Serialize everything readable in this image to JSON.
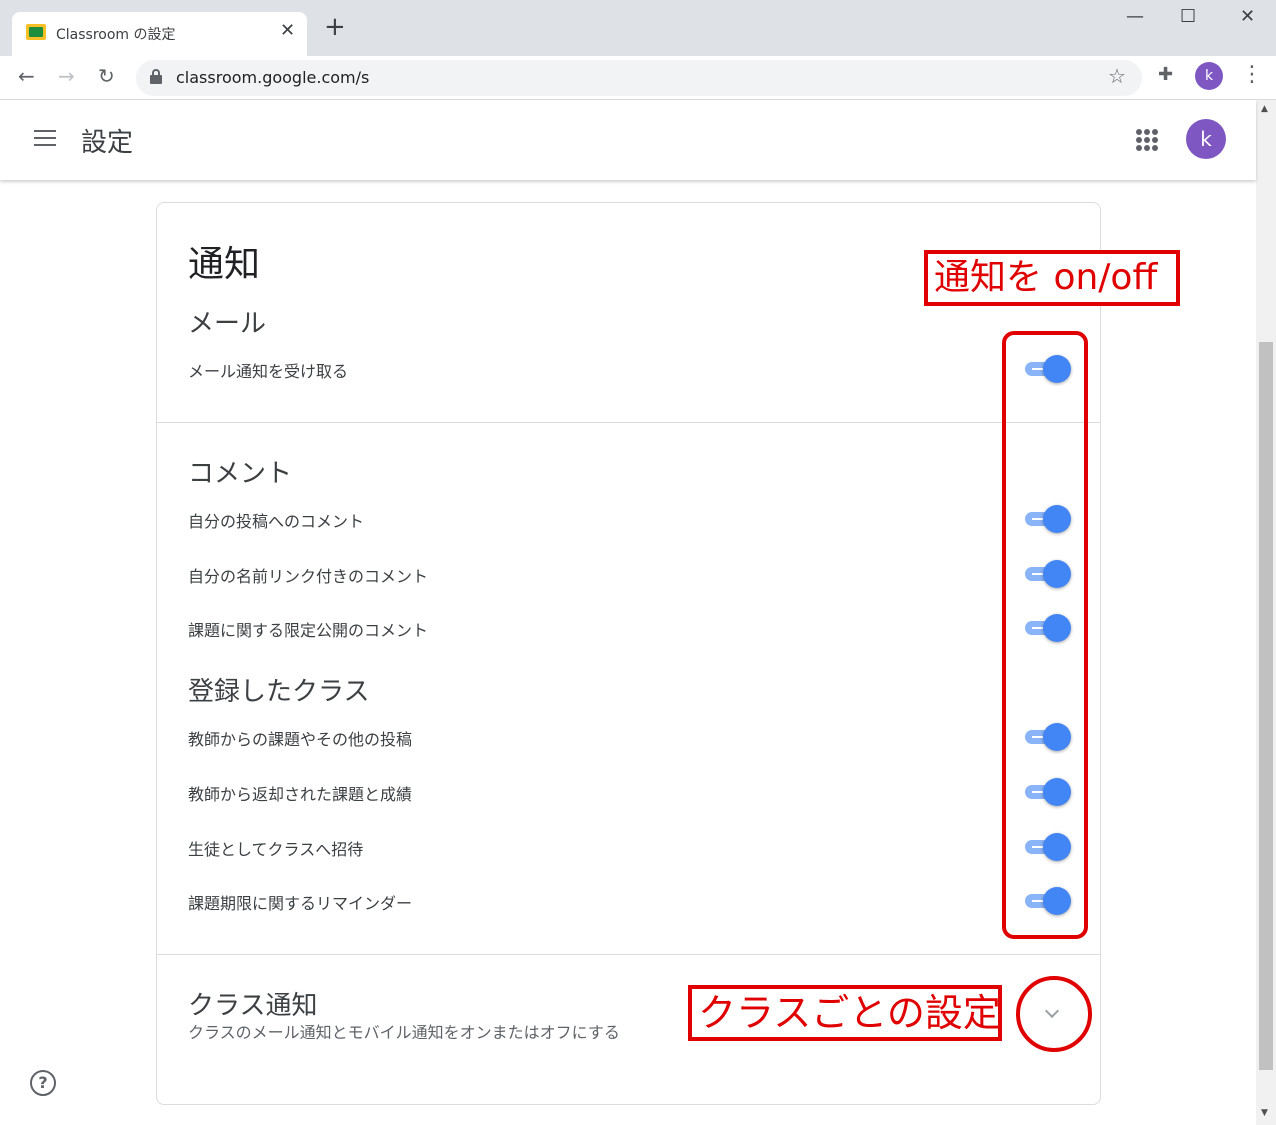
{
  "browser": {
    "tab_title": "Classroom の設定",
    "tab_close": "✕",
    "new_tab": "+",
    "url": "classroom.google.com/s",
    "profile_initial": "k",
    "win_minimize": "—",
    "win_maximize": "☐",
    "win_close": "✕"
  },
  "appbar": {
    "title": "設定",
    "profile_initial": "k"
  },
  "settings": {
    "section_title": "通知",
    "email": {
      "heading": "メール",
      "items": [
        {
          "label": "メール通知を受け取る",
          "enabled": true
        }
      ]
    },
    "comments": {
      "heading": "コメント",
      "items": [
        {
          "label": "自分の投稿へのコメント",
          "enabled": true
        },
        {
          "label": "自分の名前リンク付きのコメント",
          "enabled": true
        },
        {
          "label": "課題に関する限定公開のコメント",
          "enabled": true
        }
      ]
    },
    "classes": {
      "heading": "登録したクラス",
      "items": [
        {
          "label": "教師からの課題やその他の投稿",
          "enabled": true
        },
        {
          "label": "教師から返却された課題と成績",
          "enabled": true
        },
        {
          "label": "生徒としてクラスへ招待",
          "enabled": true
        },
        {
          "label": "課題期限に関するリマインダー",
          "enabled": true
        }
      ]
    },
    "class_notifications": {
      "heading": "クラス通知",
      "description": "クラスのメール通知とモバイル通知をオンまたはオフにする"
    }
  },
  "help_label": "?",
  "annotations": {
    "toggle_note": "通知を on/off",
    "class_note": "クラスごとの設定",
    "color": "#e00000"
  },
  "colors": {
    "toggle_knob": "#4285f4",
    "toggle_track": "#8ab4f8",
    "avatar": "#7e57c2"
  }
}
